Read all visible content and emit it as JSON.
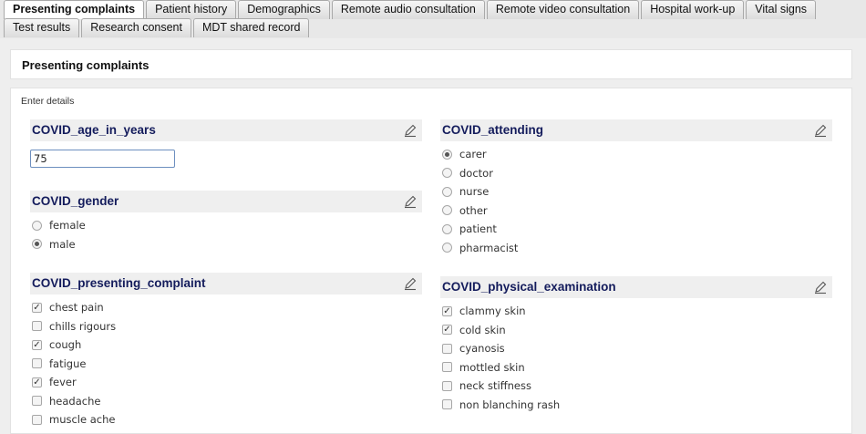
{
  "tabs": {
    "row1": [
      "Presenting complaints",
      "Patient history",
      "Demographics",
      "Remote audio consultation",
      "Remote video consultation",
      "Hospital work-up",
      "Vital signs"
    ],
    "row2": [
      "Test results",
      "Research consent",
      "MDT shared record"
    ],
    "active": "Presenting complaints"
  },
  "panel": {
    "title": "Presenting complaints",
    "subtitle": "Enter details"
  },
  "fields": {
    "age": {
      "title": "COVID_age_in_years",
      "value": "75"
    },
    "attending": {
      "title": "COVID_attending",
      "options": [
        "carer",
        "doctor",
        "nurse",
        "other",
        "patient",
        "pharmacist"
      ],
      "selected": "carer"
    },
    "gender": {
      "title": "COVID_gender",
      "options": [
        "female",
        "male"
      ],
      "selected": "male"
    },
    "complaint": {
      "title": "COVID_presenting_complaint",
      "options": [
        {
          "label": "chest pain",
          "checked": true
        },
        {
          "label": "chills rigours",
          "checked": false
        },
        {
          "label": "cough",
          "checked": true
        },
        {
          "label": "fatigue",
          "checked": false
        },
        {
          "label": "fever",
          "checked": true
        },
        {
          "label": "headache",
          "checked": false
        },
        {
          "label": "muscle ache",
          "checked": false
        }
      ]
    },
    "exam": {
      "title": "COVID_physical_examination",
      "options": [
        {
          "label": "clammy skin",
          "checked": true
        },
        {
          "label": "cold skin",
          "checked": true
        },
        {
          "label": "cyanosis",
          "checked": false
        },
        {
          "label": "mottled skin",
          "checked": false
        },
        {
          "label": "neck stiffness",
          "checked": false
        },
        {
          "label": "non blanching rash",
          "checked": false
        }
      ]
    }
  }
}
